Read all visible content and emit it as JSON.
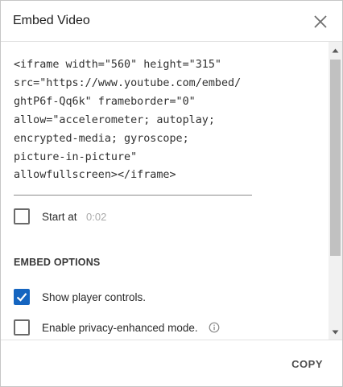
{
  "dialog": {
    "title": "Embed Video",
    "close_icon": "close-icon"
  },
  "embed_code": {
    "lines": [
      "<iframe width=\"560\" height=\"315\"",
      "src=\"https://www.youtube.com/embed/",
      "ghtP6f-Qq6k\" frameborder=\"0\"",
      "allow=\"accelerometer; autoplay;",
      "encrypted-media; gyroscope;",
      "picture-in-picture\"",
      "allowfullscreen></iframe>"
    ]
  },
  "start_at": {
    "label": "Start at",
    "time": "0:02",
    "checked": false
  },
  "embed_options": {
    "title": "EMBED OPTIONS",
    "options": [
      {
        "label": "Show player controls.",
        "checked": true
      },
      {
        "label": "Enable privacy-enhanced mode.",
        "checked": false,
        "icon": "info-icon"
      }
    ]
  },
  "footer": {
    "copy_label": "COPY"
  },
  "colors": {
    "accent": "#1565c0",
    "checkbox_border": "#6a6a6a",
    "muted_text": "#aaaaaa"
  }
}
